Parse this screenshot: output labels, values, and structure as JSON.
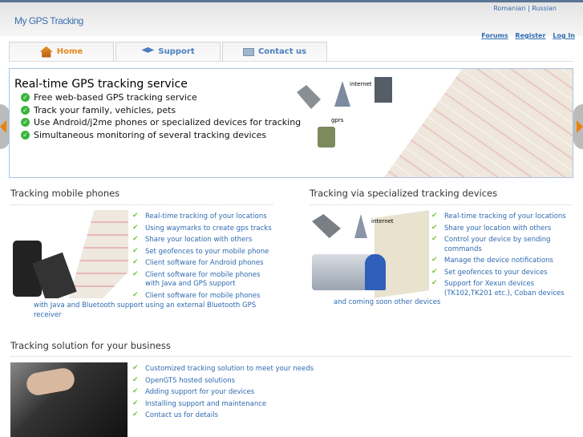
{
  "header": {
    "logo": "My GPS Tracking",
    "lang_romanian": "Romanian",
    "lang_sep": "|",
    "lang_russian": "Russian",
    "forums": "Forums",
    "register": "Register",
    "login": "Log In"
  },
  "tabs": [
    {
      "label": "Home",
      "icon": "home-icon"
    },
    {
      "label": "Support",
      "icon": "graduation-cap-icon"
    },
    {
      "label": "Contact us",
      "icon": "contact-card-icon"
    }
  ],
  "banner": {
    "title": "Real-time GPS tracking service",
    "items": [
      "Free web-based GPS tracking service",
      "Track your family, vehicles, pets",
      "Use Android/j2me phones or specialized devices for tracking",
      "Simultaneous monitoring of several tracking devices"
    ],
    "internet_label": "internet",
    "gprs_label": "gprs"
  },
  "mobile": {
    "title": "Tracking mobile phones",
    "items": [
      "Real-time tracking of your locations",
      "Using waymarks to create gps tracks",
      "Share your location with others",
      "Set geofences to your mobile phone",
      "Client software for Android phones",
      "Client software for mobile phones with Java and GPS support",
      "Client software for mobile phones"
    ],
    "continuation": "with Java and Bluetooth support using an external Bluetooth GPS receiver"
  },
  "devices": {
    "title": "Tracking via specialized tracking devices",
    "items": [
      "Real-time tracking of your locations",
      "Share your location with others",
      "Control your device by sending commands",
      "Manage the device notifications",
      "Set geofences to your devices",
      "Support for Xexun devices (TK102,TK201 etc.), Coban devices"
    ],
    "continuation": "and coming soon other devices",
    "internet_label": "internet"
  },
  "business": {
    "title": "Tracking solution for your business",
    "items": [
      "Customized tracking solution to meet your needs",
      "OpenGTS hosted solutions",
      "Adding support for your devices",
      "Installing support and maintenance",
      "Contact us for details"
    ]
  }
}
